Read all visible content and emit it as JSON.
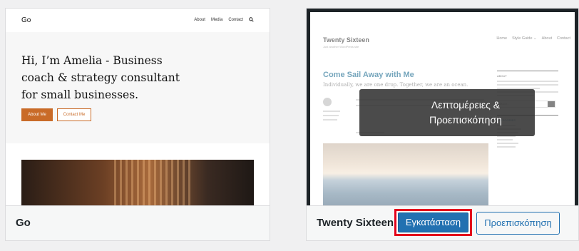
{
  "themes": [
    {
      "name": "Go",
      "preview": {
        "logo": "Go",
        "nav": [
          "About",
          "Media",
          "Contact"
        ],
        "headline": "Hi, I’m Amelia - Business coach & strategy consultant for small businesses.",
        "primary_button": "About Me",
        "secondary_button": "Contact Me"
      }
    },
    {
      "name": "Twenty Sixteen",
      "preview": {
        "site_title": "Twenty Sixteen",
        "tagline": "Just another WordPress site",
        "nav": [
          "Home",
          "Style Guide ⌄",
          "About",
          "Contact"
        ],
        "post_title": "Come Sail Away with Me",
        "excerpt": "Individually, we are one drop. Together, we are an ocean.",
        "sidebar_about": "ABOUT",
        "sidebar_search": "Search...",
        "sidebar_categories": "CATEGORIES"
      },
      "overlay_label": "Λεπτομέρειες & Προεπισκόπηση",
      "install_button": "Εγκατάσταση",
      "preview_button": "Προεπισκόπηση"
    }
  ],
  "colors": {
    "accent": "#2271b1",
    "highlight": "#e3001b",
    "go_brand": "#c96b28"
  }
}
